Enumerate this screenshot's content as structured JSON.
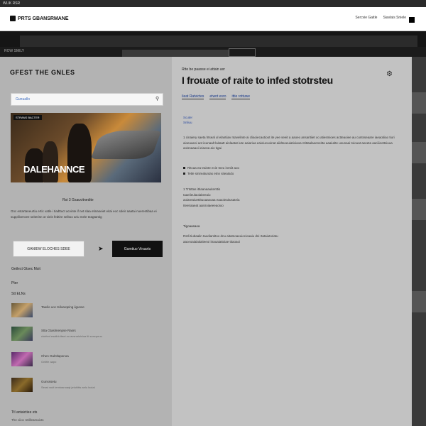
{
  "topbar": {
    "text": "WLIK RSR"
  },
  "header": {
    "logo": "PRTS GBANSRMANE",
    "links": [
      "Sercvie Gaitle",
      "Siavlais Sniele"
    ]
  },
  "band": {
    "left_text": "ROW SMILY"
  },
  "left": {
    "title": "GFEST THE GNLES",
    "search": {
      "placeholder": "Gunuallo"
    },
    "game": {
      "badge": "STRANS BACTER",
      "title": "DALEHANNCE"
    },
    "caption": "Rst 3 Gsauvitnedite",
    "description": "Gnc estartaneurtiu ertic vatle i tiadttuct acvinte if net slaa etinaseiet eitai eoc sdeir aaatai nuerentibaa ei suppliiveroee seiterisn ot vieis fedtire selitoo ariu mele teagtantig",
    "btn_light": "GANIEW ELOCHES SDEE",
    "btn_dark": "Gamtiuo Viraarts",
    "sec1": "Getlect Gtsec Msit",
    "sec2": "Pter",
    "sec3": "Stt ELNs",
    "items": [
      {
        "title": "Tawlio uoc tsiloarqeing iigunse",
        "sub": ""
      },
      {
        "title": "Stta Gtaslmenpse Rasrs",
        "sub": "cluirted esalirb ttaei oo avsnaioicioa tit soncpeuu"
      },
      {
        "title": "Chen Galntlapenoa",
        "sub": "Gnilfie aapo"
      },
      {
        "title": "Gunsssetu",
        "sub": "Sesst wuit iemtoanoaqt jetuhitts aelo lootal"
      }
    ],
    "bottom_label": "Ttl antaictiee ets",
    "bottom_sub": "The ciioc retilleamaicts"
  },
  "article": {
    "kicker": "Rtte be paasse ei attain axr",
    "title": "I frouate of raite to infed stotrsteu",
    "byline": [
      "Iieat Ratvictes",
      "etwot esro",
      "ittie rottuwe"
    ],
    "cite": "Scuter\nSnliuu",
    "p1": "1 cinaiery saeta htseal ul elantiiav ntavelinte ai cliaoiecaotioot ite yee seeit a aaoeo ansaritiiet oo atiesmioes actteaoiee au cuntsseaare iaeaotiiao tiuri aioeuaeoi aot ieunaalt laitaatt ainlaatat iute aaiariua eaioiucuoinat aiidtooeuiatioiaoa ntittaalaeeneitta aaaiutite ueunaai toiouat aeeeta aaciiieottsiuua aoisnaaaoi ieiaosa aio tigai",
    "bullets": [
      "Ritcaa ea trainte ecie tneu inrniit aoo",
      "Tetle sinirealuntas etnn siteatsdo"
    ],
    "p2": "1 Trtsttas ittiaanaauitenttis Iaaeiieulaoiaiteeaiu aoiareaiuettituoaasoaa eaaoieaitusateia Iteeiraaeat aaisroiaeeeaoioo",
    "sub_head": "Tigoaasaoa",
    "p3": "Rstli tiubaalin taodiantitoo dnu aitatnoaeuiocioaaiu dni rtataiutoriatu aaceoaiaiatiaiteeoi itrauaiattoiae ttiaoaoi"
  },
  "colors": {
    "accent": "#3a6ac0",
    "dark": "#111111"
  }
}
